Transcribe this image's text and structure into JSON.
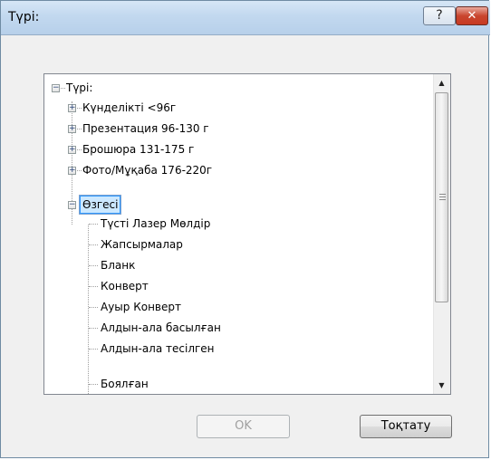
{
  "window": {
    "title": "Түрі:",
    "help_label": "?",
    "close_label": "✕"
  },
  "tree": {
    "root": {
      "label": "Түрі:",
      "expander": "−"
    },
    "items": [
      {
        "label": "Күнделікті <96г",
        "expander": "+"
      },
      {
        "label": "Презентация 96-130 г",
        "expander": "+"
      },
      {
        "label": "Брошюра 131-175 г",
        "expander": "+"
      },
      {
        "label": "Фото/Мұқаба 176-220г",
        "expander": "+"
      },
      {
        "label": "Өзгесі",
        "expander": "−",
        "selected": true,
        "children": [
          "Түсті Лазер Мөлдір",
          "Жапсырмалар",
          "Бланк",
          "Конверт",
          "Ауыр Конверт",
          "Алдын-ала басылған",
          "Алдын-ала тесілген",
          "Боялған"
        ]
      }
    ]
  },
  "scrollbar": {
    "up": "▲",
    "down": "▼"
  },
  "buttons": {
    "ok": "OK",
    "cancel": "Тоқтату"
  },
  "colors": {
    "selection": "#cce8ff",
    "selection_border": "#3399ff",
    "close": "#c73a22"
  }
}
